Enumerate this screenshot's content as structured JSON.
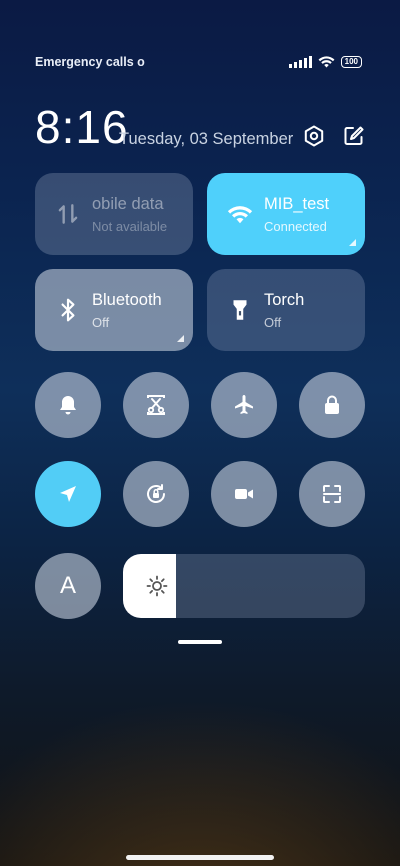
{
  "status_bar": {
    "carrier_text": "Emergency calls o",
    "battery": "100",
    "icons": [
      "signal-icon",
      "wifi-icon",
      "battery-icon"
    ]
  },
  "header": {
    "time": "8:16",
    "date": "Tuesday, 03 September",
    "icons": [
      "settings-icon",
      "edit-icon"
    ]
  },
  "tiles": {
    "mobile_data": {
      "title": "obile data",
      "subtitle": "Not available",
      "state": "disabled"
    },
    "wifi": {
      "title": "MIB_test",
      "subtitle": "Connected",
      "state": "on"
    },
    "bluetooth": {
      "title": "Bluetooth",
      "subtitle": "Off",
      "state": "off"
    },
    "torch": {
      "title": "Torch",
      "subtitle": "Off",
      "state": "off"
    }
  },
  "toggles": [
    {
      "name": "silent-toggle",
      "icon": "bell-icon",
      "active": false
    },
    {
      "name": "screenshot-toggle",
      "icon": "scissors-icon",
      "active": false
    },
    {
      "name": "airplane-toggle",
      "icon": "airplane-icon",
      "active": false
    },
    {
      "name": "lock-toggle",
      "icon": "lock-icon",
      "active": false
    },
    {
      "name": "location-toggle",
      "icon": "location-arrow-icon",
      "active": true
    },
    {
      "name": "auto-rotate-toggle",
      "icon": "rotation-lock-icon",
      "active": false
    },
    {
      "name": "screen-recorder-toggle",
      "icon": "video-camera-icon",
      "active": false
    },
    {
      "name": "scanner-toggle",
      "icon": "scan-icon",
      "active": false
    }
  ],
  "auto_brightness": {
    "letter": "A"
  },
  "brightness": {
    "level_fraction": 0.22
  },
  "colors": {
    "accent": "#4fd0fb",
    "tile_inactive": "rgba(190,200,215,0.62)"
  }
}
